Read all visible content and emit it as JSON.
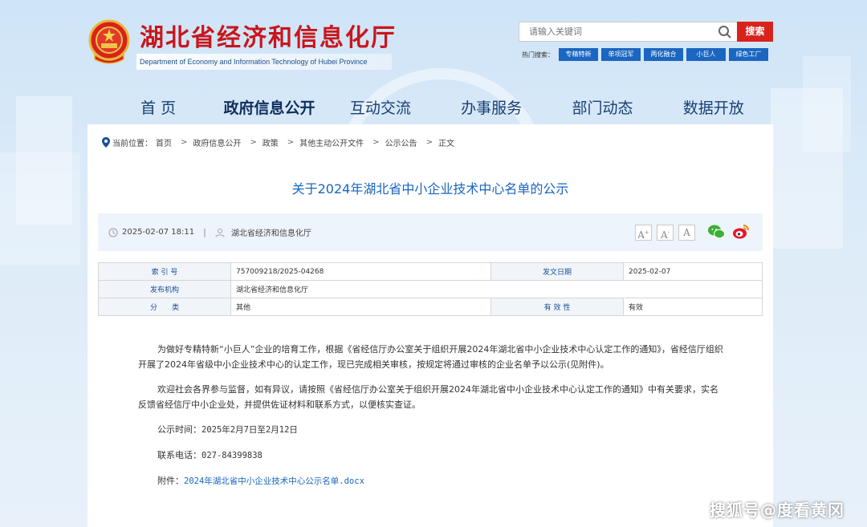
{
  "header": {
    "site_title": "湖北省经济和信息化厅",
    "site_subtitle": "Department of Economy and Information Technology of Hubei Province",
    "search_placeholder": "请输入关键词",
    "search_button": "搜索",
    "hot_label": "热门搜索：",
    "hot_tags": [
      "专精特新",
      "单项冠军",
      "两化融合",
      "小巨人",
      "绿色工厂"
    ]
  },
  "nav": {
    "items": [
      "首 页",
      "政府信息公开",
      "互动交流",
      "办事服务",
      "部门动态",
      "数据开放"
    ],
    "active_index": 1
  },
  "breadcrumb": {
    "label": "当前位置：",
    "items": [
      "首页",
      "政府信息公开",
      "政策",
      "其他主动公开文件",
      "公示公告",
      "正文"
    ],
    "separator": ">"
  },
  "article": {
    "title": "关于2024年湖北省中小企业技术中心名单的公示",
    "datetime": "2025-02-07 18:11",
    "source": "湖北省经济和信息化厅",
    "font_buttons": [
      "A",
      "A",
      "A"
    ]
  },
  "info_table": {
    "index_label": "索 引 号",
    "index_value": "757009218/2025-04268",
    "date_label": "发文日期",
    "date_value": "2025-02-07",
    "org_label": "发布机构",
    "org_value": "湖北省经济和信息化厅",
    "category_label": "分　　类",
    "category_value": "其他",
    "validity_label": "有 效 性",
    "validity_value": "有效"
  },
  "content": {
    "para1": "为做好专精特新“小巨人”企业的培育工作，根据《省经信厅办公室关于组织开展2024年湖北省中小企业技术中心认定工作的通知》，省经信厅组织开展了2024年省级中小企业技术中心的认定工作，现已完成相关审核，按规定将通过审核的企业名单予以公示(见附件)。",
    "para2": "欢迎社会各界参与监督，如有异议，请按照《省经信厅办公室关于组织开展2024年湖北省中小企业技术中心认定工作的通知》中有关要求，实名反馈省经信厅中小企业处，并提供佐证材料和联系方式，以便核实查证。",
    "period_label": "公示时间：",
    "period_value": "2025年2月7日至2月12日",
    "phone_label": "联系电话：",
    "phone_value": "027-84399838",
    "attach_label": "附件：",
    "attach_link": "2024年湖北省中小企业技术中心公示名单.docx"
  },
  "watermark": "搜狐号@度看黄冈",
  "colors": {
    "brand_red": "#c8161d",
    "link_blue": "#1a66c0",
    "nav_blue": "#1a3e73"
  }
}
